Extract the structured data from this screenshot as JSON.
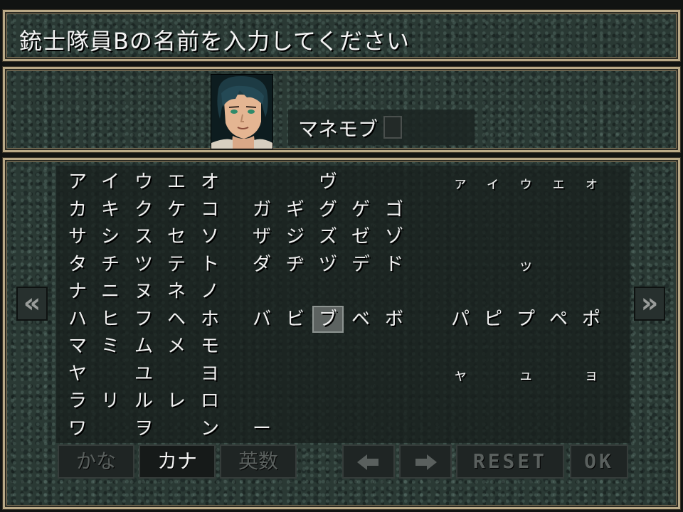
{
  "prompt": {
    "title": "銃士隊員Bの名前を入力してください"
  },
  "name_entry": {
    "value": "マネモブ"
  },
  "character_grid": {
    "rows": [
      [
        "ア",
        "イ",
        "ウ",
        "エ",
        "オ",
        "",
        "",
        "ヴ",
        "",
        "",
        "",
        "ァ",
        "ィ",
        "ゥ",
        "ェ",
        "ォ"
      ],
      [
        "カ",
        "キ",
        "ク",
        "ケ",
        "コ",
        "ガ",
        "ギ",
        "グ",
        "ゲ",
        "ゴ",
        "",
        "",
        "",
        "",
        "",
        ""
      ],
      [
        "サ",
        "シ",
        "ス",
        "セ",
        "ソ",
        "ザ",
        "ジ",
        "ズ",
        "ゼ",
        "ゾ",
        "",
        "",
        "",
        "",
        "",
        ""
      ],
      [
        "タ",
        "チ",
        "ツ",
        "テ",
        "ト",
        "ダ",
        "ヂ",
        "ヅ",
        "デ",
        "ド",
        "",
        "",
        "",
        "ッ",
        "",
        ""
      ],
      [
        "ナ",
        "ニ",
        "ヌ",
        "ネ",
        "ノ",
        "",
        "",
        "",
        "",
        "",
        "",
        "",
        "",
        "",
        "",
        ""
      ],
      [
        "ハ",
        "ヒ",
        "フ",
        "ヘ",
        "ホ",
        "バ",
        "ビ",
        "ブ",
        "ベ",
        "ボ",
        "",
        "パ",
        "ピ",
        "プ",
        "ペ",
        "ポ"
      ],
      [
        "マ",
        "ミ",
        "ム",
        "メ",
        "モ",
        "",
        "",
        "",
        "",
        "",
        "",
        "",
        "",
        "",
        "",
        ""
      ],
      [
        "ヤ",
        "",
        "ユ",
        "",
        "ヨ",
        "",
        "",
        "",
        "",
        "",
        "",
        "ャ",
        "",
        "ュ",
        "",
        "ョ"
      ],
      [
        "ラ",
        "リ",
        "ル",
        "レ",
        "ロ",
        "",
        "",
        "",
        "",
        "",
        "",
        "",
        "",
        "",
        "",
        ""
      ],
      [
        "ワ",
        "",
        "ヲ",
        "",
        "ン",
        "ー",
        "",
        "",
        "",
        "",
        "",
        "",
        "",
        "",
        "",
        ""
      ]
    ],
    "selected_char": "ブ",
    "prev_page_glyph": "«",
    "next_page_glyph": "»"
  },
  "buttons": {
    "hiragana": "かな",
    "katakana": "カナ",
    "alnum": "英数",
    "left_arrow_icon": "arrow-left-icon",
    "right_arrow_icon": "arrow-right-icon",
    "reset": "RESET",
    "ok": "OK",
    "active_mode": "カナ"
  },
  "colors": {
    "frame_gold": "#b9a987",
    "panel_teal": "#2a3934",
    "selected_bg": "#5d6361"
  }
}
